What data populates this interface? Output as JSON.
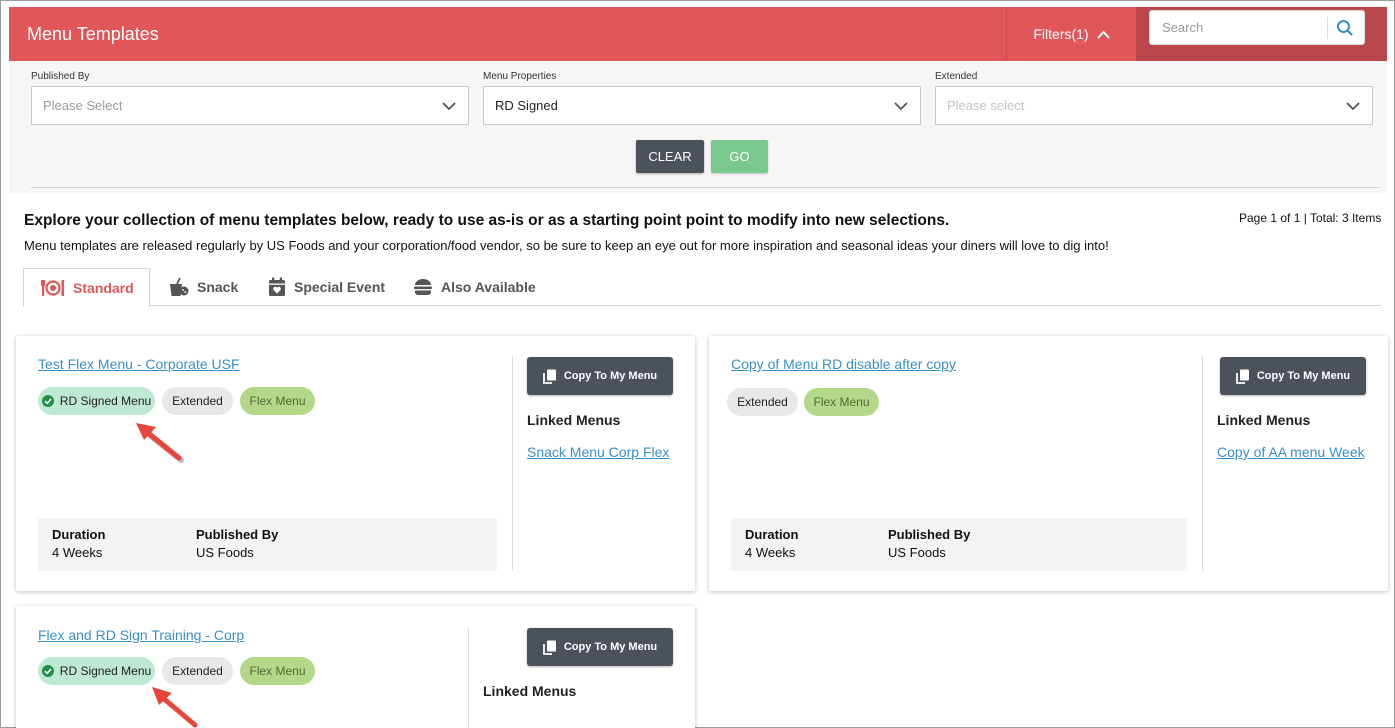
{
  "header": {
    "title": "Menu Templates",
    "filters_label": "Filters(1)",
    "search_placeholder": "Search"
  },
  "filters": {
    "published_by": {
      "label": "Published By",
      "placeholder": "Please Select"
    },
    "menu_properties": {
      "label": "Menu Properties",
      "value": "RD Signed"
    },
    "extended": {
      "label": "Extended",
      "placeholder": "Please select"
    },
    "clear_label": "CLEAR",
    "go_label": "GO"
  },
  "intro": {
    "heading": "Explore your collection of menu templates below, ready to use as-is or as a starting point point to modify into new selections.",
    "text": "Menu templates are released regularly by US Foods and your corporation/food vendor, so be sure to keep an eye out for more inspiration and seasonal ideas your diners will love to dig into!",
    "paging": "Page 1 of 1 | Total: 3 Items"
  },
  "tabs": [
    {
      "label": "Standard",
      "icon": "plate-cutlery-icon",
      "active": true
    },
    {
      "label": "Snack",
      "icon": "snack-icon",
      "active": false
    },
    {
      "label": "Special Event",
      "icon": "calendar-heart-icon",
      "active": false
    },
    {
      "label": "Also Available",
      "icon": "burger-icon",
      "active": false
    }
  ],
  "cards": [
    {
      "title": "Test Flex Menu - Corporate USF",
      "badges": [
        "RD Signed Menu",
        "Extended",
        "Flex Menu"
      ],
      "copy_label": "Copy To My Menu",
      "linked_heading": "Linked Menus",
      "linked_menu": "Snack Menu Corp Flex",
      "duration_label": "Duration",
      "duration_value": "4 Weeks",
      "published_label": "Published By",
      "published_value": "US Foods"
    },
    {
      "title": "Copy of Menu RD disable after copy",
      "badges": [
        "Extended",
        "Flex Menu"
      ],
      "copy_label": "Copy To My Menu",
      "linked_heading": "Linked Menus",
      "linked_menu": "Copy of AA menu Week",
      "duration_label": "Duration",
      "duration_value": "4 Weeks",
      "published_label": "Published By",
      "published_value": "US Foods"
    },
    {
      "title": "Flex and RD Sign Training - Corp",
      "badges": [
        "RD Signed Menu",
        "Extended",
        "Flex Menu"
      ],
      "copy_label": "Copy To My Menu",
      "linked_heading": "Linked Menus"
    }
  ],
  "colors": {
    "header_red": "#e05659",
    "link_blue": "#3a8fc8",
    "rd_badge_green": "#bfe9d3",
    "flex_badge_green": "#b3d88a",
    "dark_button": "#4b5259",
    "go_green": "#79c98f",
    "annotation_arrow": "#e8453c"
  }
}
